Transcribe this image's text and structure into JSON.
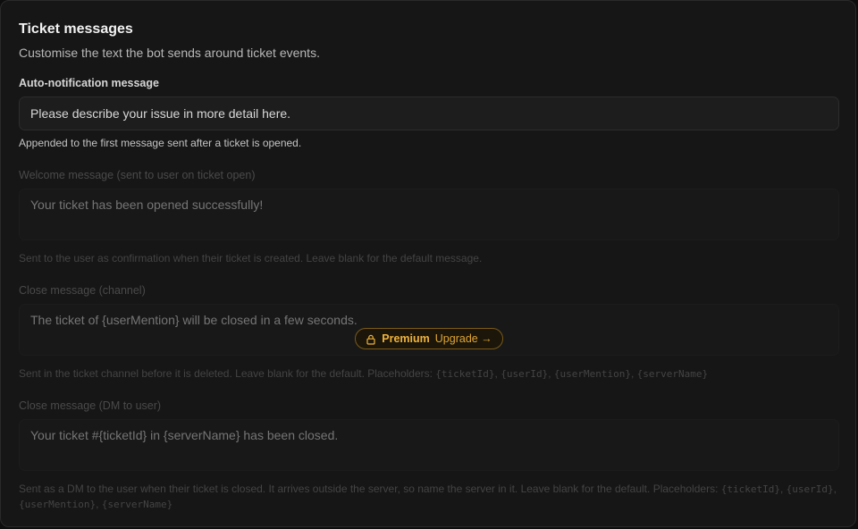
{
  "section": {
    "title": "Ticket messages",
    "subtitle": "Customise the text the bot sends around ticket events."
  },
  "auto_notification": {
    "label": "Auto-notification message",
    "value": "Please describe your issue in more detail here.",
    "help": "Appended to the first message sent after a ticket is opened."
  },
  "welcome": {
    "label": "Welcome message (sent to user on ticket open)",
    "placeholder": "Your ticket has been opened successfully!",
    "help": "Sent to the user as confirmation when their ticket is created. Leave blank for the default message."
  },
  "close_channel": {
    "label": "Close message (channel)",
    "placeholder": "The ticket of {userMention} will be closed in a few seconds.",
    "help_prefix": "Sent in the ticket channel before it is deleted. Leave blank for the default. Placeholders: ",
    "placeholders": [
      "{ticketId}",
      "{userId}",
      "{userMention}",
      "{serverName}"
    ]
  },
  "close_dm": {
    "label": "Close message (DM to user)",
    "placeholder": "Your ticket #{ticketId} in {serverName} has been closed.",
    "help_prefix": "Sent as a DM to the user when their ticket is closed. It arrives outside the server, so name the server in it. Leave blank for the default. Placeholders: ",
    "placeholders": [
      "{ticketId}",
      "{userId}",
      "{userMention}",
      "{serverName}"
    ]
  },
  "premium": {
    "badge": "Premium",
    "cta": "Upgrade →",
    "icon": "lock-icon",
    "color": "#f0b33c"
  }
}
